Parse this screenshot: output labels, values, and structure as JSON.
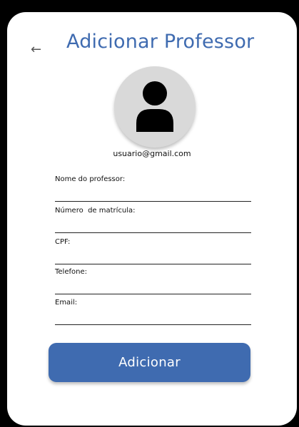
{
  "header": {
    "back_icon": "←",
    "title": "Adicionar Professor"
  },
  "avatar": {
    "icon": "user-silhouette-icon",
    "email": "usuario@gmail.com"
  },
  "form": {
    "fields": [
      {
        "label": "Nome do professor:",
        "value": ""
      },
      {
        "label": "Número  de matrícula:",
        "value": ""
      },
      {
        "label": "CPF:",
        "value": ""
      },
      {
        "label": "Telefone:",
        "value": ""
      },
      {
        "label": "Email:",
        "value": ""
      }
    ]
  },
  "actions": {
    "submit_label": "Adicionar"
  },
  "colors": {
    "accent": "#3f6bb0",
    "background": "#000000",
    "card": "#ffffff",
    "avatar_bg": "#d9d9d9"
  }
}
